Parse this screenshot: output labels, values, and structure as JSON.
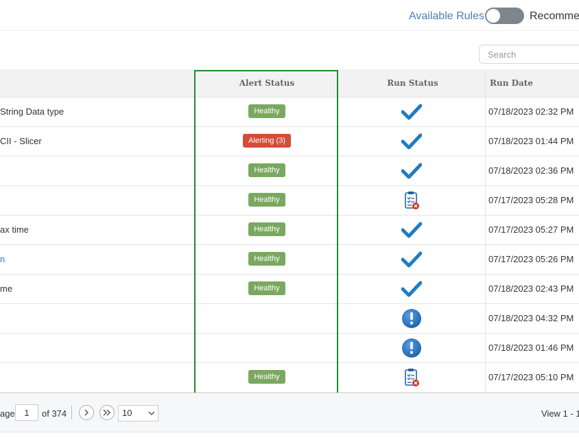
{
  "header": {
    "available_rules_label": "Available Rules",
    "recommend_label": "Recommen",
    "search_placeholder": "Search"
  },
  "table": {
    "columns": {
      "alert_status": "Alert Status",
      "run_status": "Run Status",
      "run_date": "Run Date"
    },
    "rows": [
      {
        "name": "String Data type",
        "link": false,
        "alert": "Healthy",
        "alert_type": "healthy",
        "run": "check-icon",
        "date": "07/18/2023 02:32 PM"
      },
      {
        "name": "CII - Slicer",
        "link": false,
        "alert": "Alerting (3)",
        "alert_type": "alerting",
        "run": "check-icon",
        "date": "07/18/2023 01:44 PM"
      },
      {
        "name": "",
        "link": false,
        "alert": "Healthy",
        "alert_type": "healthy",
        "run": "check-icon",
        "date": "07/18/2023 02:36 PM"
      },
      {
        "name": "",
        "link": false,
        "alert": "Healthy",
        "alert_type": "healthy",
        "run": "clipboard-error-icon",
        "date": "07/17/2023 05:28 PM"
      },
      {
        "name": "ax time",
        "link": false,
        "alert": "Healthy",
        "alert_type": "healthy",
        "run": "check-icon",
        "date": "07/17/2023 05:27 PM"
      },
      {
        "name": "n",
        "link": true,
        "alert": "Healthy",
        "alert_type": "healthy",
        "run": "check-icon",
        "date": "07/17/2023 05:26 PM"
      },
      {
        "name": "me",
        "link": false,
        "alert": "Healthy",
        "alert_type": "healthy",
        "run": "check-icon",
        "date": "07/18/2023 02:43 PM"
      },
      {
        "name": "",
        "link": false,
        "alert": "",
        "alert_type": "none",
        "run": "exclamation-icon",
        "date": "07/18/2023 04:32 PM"
      },
      {
        "name": "",
        "link": false,
        "alert": "",
        "alert_type": "none",
        "run": "exclamation-icon",
        "date": "07/18/2023 01:46 PM"
      },
      {
        "name": "",
        "link": false,
        "alert": "Healthy",
        "alert_type": "healthy",
        "run": "clipboard-error-icon",
        "date": "07/17/2023 05:10 PM"
      }
    ]
  },
  "pager": {
    "page_label": "age",
    "page_value": "1",
    "of_label": "of 374",
    "per_page": "10",
    "view_label": "View 1 - 1"
  },
  "colors": {
    "healthy": "#7aa860",
    "alerting": "#d24d3a",
    "check": "#1f7cc4",
    "highlight": "#1f8a2e"
  }
}
